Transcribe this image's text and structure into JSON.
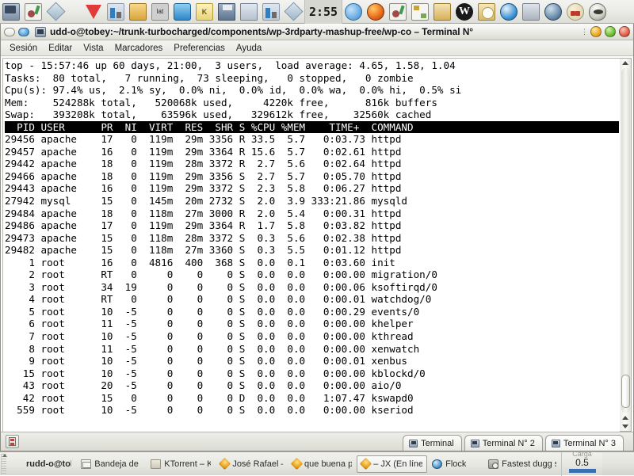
{
  "top_panel": {
    "clock": "2:55",
    "left_icons": [
      {
        "name": "terminal-launcher-icon",
        "glyph": "monitor"
      },
      {
        "name": "text-editor-icon",
        "glyph": "editor"
      },
      {
        "name": "diamond-app-icon",
        "glyph": "diamond"
      }
    ],
    "tray_icons": [
      {
        "name": "ruby-gem-icon",
        "glyph": "gem"
      },
      {
        "name": "network-icon",
        "glyph": "network"
      },
      {
        "name": "archive-icon",
        "glyph": "box"
      },
      {
        "name": "keyboard-layout-icon",
        "glyph": "lat",
        "label": "lat"
      },
      {
        "name": "volume-icon",
        "glyph": "speaker"
      },
      {
        "name": "klipper-icon",
        "glyph": "clip",
        "label": "K"
      },
      {
        "name": "save-session-icon",
        "glyph": "floppy"
      },
      {
        "name": "update-notifier-icon",
        "glyph": "mail"
      },
      {
        "name": "system-monitor-icon",
        "glyph": "bars"
      },
      {
        "name": "diamond-tray-icon",
        "glyph": "diamond"
      }
    ],
    "right_icons": [
      {
        "name": "msn-messenger-icon",
        "glyph": "msn"
      },
      {
        "name": "firefox-icon",
        "glyph": "firefox"
      },
      {
        "name": "paint-app-icon",
        "glyph": "paint"
      },
      {
        "name": "tools-app-icon",
        "glyph": "tools"
      },
      {
        "name": "file-manager-icon",
        "glyph": "folders"
      },
      {
        "name": "wordpress-icon",
        "glyph": "wp",
        "label": "W"
      },
      {
        "name": "photo-viewer-icon",
        "glyph": "photo"
      },
      {
        "name": "web-browser-icon",
        "glyph": "globe"
      },
      {
        "name": "display-settings-icon",
        "glyph": "screen"
      },
      {
        "name": "wolf-app-icon",
        "glyph": "wolf"
      },
      {
        "name": "baseball-app-icon",
        "glyph": "cream"
      },
      {
        "name": "penguin-app-icon",
        "glyph": "penguin"
      }
    ]
  },
  "window": {
    "title": "udd-o@tobey:~/trunk-turbocharged/components/wp-3rdparty-mashup-free/wp-co – Terminal N°",
    "menu": [
      "Sesión",
      "Editar",
      "Vista",
      "Marcadores",
      "Preferencias",
      "Ayuda"
    ],
    "tabs": [
      {
        "label": "Terminal",
        "active": false
      },
      {
        "label": "Terminal N° 2",
        "active": false
      },
      {
        "label": "Terminal N° 3",
        "active": true
      }
    ]
  },
  "terminal": {
    "summary": [
      "top - 15:57:46 up 60 days, 21:00,  3 users,  load average: 4.65, 1.58, 1.04",
      "Tasks:  80 total,   7 running,  73 sleeping,   0 stopped,   0 zombie",
      "Cpu(s): 97.4% us,  2.1% sy,  0.0% ni,  0.0% id,  0.0% wa,  0.0% hi,  0.5% si",
      "Mem:    524288k total,   520068k used,     4220k free,      816k buffers",
      "Swap:   393208k total,    63596k used,   329612k free,    32560k cached"
    ],
    "header": "  PID USER      PR  NI  VIRT  RES  SHR S %CPU %MEM    TIME+  COMMAND",
    "rows": [
      "29456 apache    17   0  119m  29m 3356 R 33.5  5.7   0:03.73 httpd",
      "29457 apache    16   0  119m  29m 3364 R 15.6  5.7   0:02.61 httpd",
      "29442 apache    18   0  119m  28m 3372 R  2.7  5.6   0:02.64 httpd",
      "29466 apache    18   0  119m  29m 3356 S  2.7  5.7   0:05.70 httpd",
      "29443 apache    16   0  119m  29m 3372 S  2.3  5.8   0:06.27 httpd",
      "27942 mysql     15   0  145m  20m 2732 S  2.0  3.9 333:21.86 mysqld",
      "29484 apache    18   0  118m  27m 3000 R  2.0  5.4   0:00.31 httpd",
      "29486 apache    17   0  119m  29m 3364 R  1.7  5.8   0:03.82 httpd",
      "29473 apache    15   0  118m  28m 3372 S  0.3  5.6   0:02.38 httpd",
      "29482 apache    15   0  118m  27m 3360 S  0.3  5.5   0:01.12 httpd",
      "    1 root      16   0  4816  400  368 S  0.0  0.1   0:03.60 init",
      "    2 root      RT   0     0    0    0 S  0.0  0.0   0:00.00 migration/0",
      "    3 root      34  19     0    0    0 S  0.0  0.0   0:00.06 ksoftirqd/0",
      "    4 root      RT   0     0    0    0 S  0.0  0.0   0:00.01 watchdog/0",
      "    5 root      10  -5     0    0    0 S  0.0  0.0   0:00.29 events/0",
      "    6 root      11  -5     0    0    0 S  0.0  0.0   0:00.00 khelper",
      "    7 root      10  -5     0    0    0 S  0.0  0.0   0:00.00 kthread",
      "    8 root      11  -5     0    0    0 S  0.0  0.0   0:00.00 xenwatch",
      "    9 root      10  -5     0    0    0 S  0.0  0.0   0:00.01 xenbus",
      "   15 root      10  -5     0    0    0 S  0.0  0.0   0:00.00 kblockd/0",
      "   43 root      20  -5     0    0    0 S  0.0  0.0   0:00.00 aio/0",
      "   42 root      15   0     0    0    0 D  0.0  0.0   1:07.47 kswapd0",
      "  559 root      10  -5     0    0    0 S  0.0  0.0   0:00.00 kseriod"
    ]
  },
  "bottom_panel": {
    "tasks": [
      {
        "label": "rudd-o@tobey",
        "icon": "terminal",
        "active": false,
        "bold": true
      },
      {
        "label": "Bandeja de en",
        "icon": "mail",
        "active": false,
        "bold": false
      },
      {
        "label": "KTorrent – Ko",
        "icon": "folder",
        "active": false,
        "bold": false
      },
      {
        "label": "José Rafael – C",
        "icon": "fox",
        "active": false,
        "bold": false
      },
      {
        "label": "que buena par",
        "icon": "fox",
        "active": false,
        "bold": false
      },
      {
        "label": "– JX (En línea)",
        "icon": "fox",
        "active": true,
        "bold": false
      },
      {
        "label": "Flock",
        "icon": "flock",
        "active": false,
        "bold": false
      },
      {
        "label": "Fastest dugg s",
        "icon": "cam",
        "active": false,
        "bold": false
      }
    ],
    "load_widget": {
      "label": "Carga",
      "value": "0.5"
    }
  },
  "colors": {
    "panel_bg": "#e9e9e5",
    "terminal_bg": "#ffffff",
    "terminal_fg": "#000000",
    "header_row_bg": "#000000",
    "header_row_fg": "#ffffff",
    "title_fg": "#16161a",
    "close_button": "#e0614b",
    "minimize_button": "#f0a828",
    "maximize_button": "#6fbf3a"
  }
}
